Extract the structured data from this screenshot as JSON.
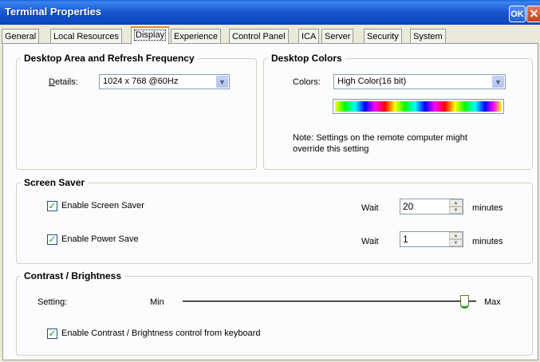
{
  "window": {
    "title": "Terminal Properties",
    "ok_label": "OK",
    "close_glyph": "✕"
  },
  "tabs": [
    {
      "label": "General"
    },
    {
      "label": "Local Resources"
    },
    {
      "label": "Display"
    },
    {
      "label": "Experience"
    },
    {
      "label": "Control Panel"
    },
    {
      "label": "ICA"
    },
    {
      "label": "Server"
    },
    {
      "label": "Security"
    },
    {
      "label": "System"
    }
  ],
  "desktop_area": {
    "title": "Desktop Area and Refresh Frequency",
    "details_label": "Details:",
    "details_value": "1024 x 768 @60Hz"
  },
  "desktop_colors": {
    "title": "Desktop Colors",
    "colors_label": "Colors:",
    "colors_value": "High Color(16 bit)",
    "note_line1": "Note: Settings on the remote computer might",
    "note_line2": "override this setting"
  },
  "screen_saver": {
    "title": "Screen Saver",
    "enable_screen_saver_label": "Enable Screen Saver",
    "enable_screen_saver_checked": true,
    "wait1_label": "Wait",
    "wait1_value": "20",
    "wait1_unit": "minutes",
    "enable_power_save_label": "Enable Power Save",
    "enable_power_save_checked": true,
    "wait2_label": "Wait",
    "wait2_value": "1",
    "wait2_unit": "minutes"
  },
  "contrast": {
    "title": "Contrast / Brightness",
    "setting_label": "Setting:",
    "min_label": "Min",
    "max_label": "Max",
    "slider_level": 0.96,
    "keyboard_control_label": "Enable Contrast / Brightness control from keyboard",
    "keyboard_control_checked": true
  },
  "glyphs": {
    "check": "✓",
    "dropdown_arrow": "▼",
    "spin_up": "▲",
    "spin_down": "▼"
  },
  "colors": {
    "titlebar": "#0a46bd",
    "active_tab_accent": "#e68b2c",
    "check": "#21a121"
  }
}
